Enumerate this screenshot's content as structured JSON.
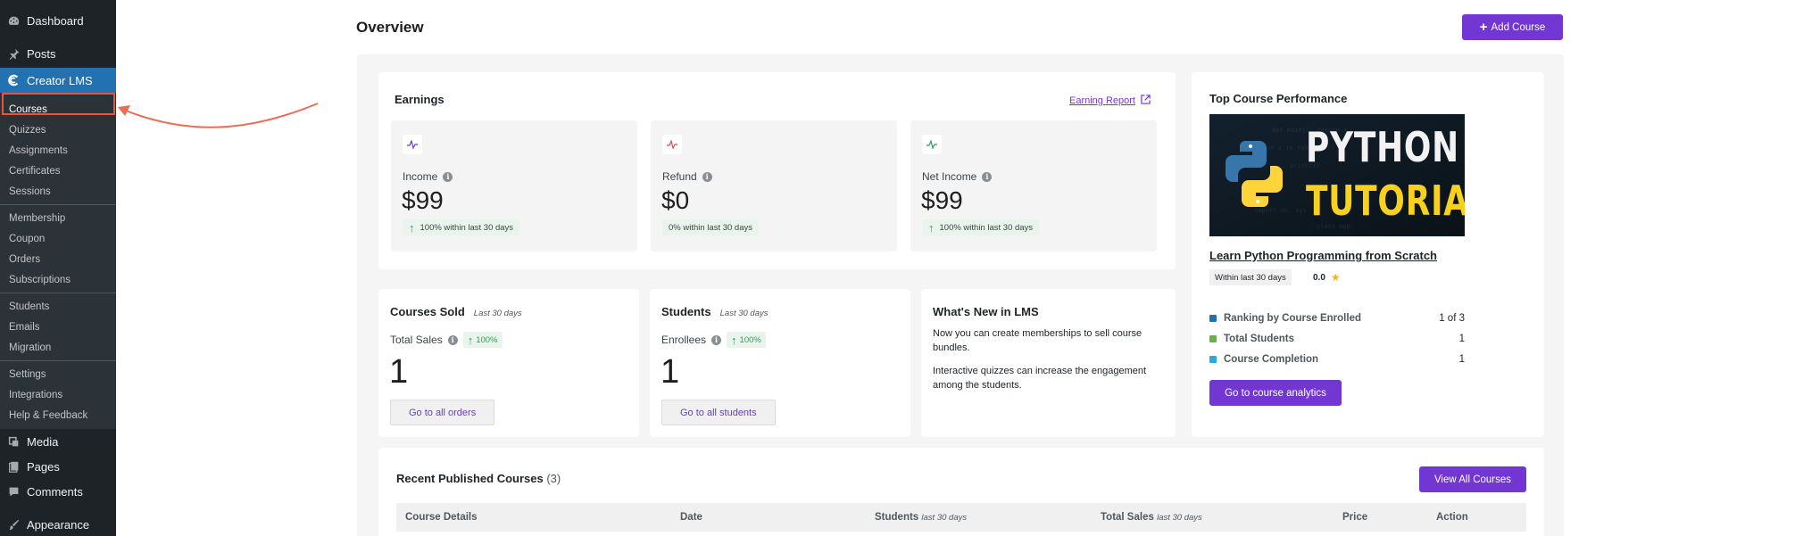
{
  "sidebar": {
    "top_items": [
      {
        "label": "Dashboard",
        "icon": "dashboard-icon"
      },
      {
        "label": "Posts",
        "icon": "pin-icon"
      },
      {
        "label": "Creator LMS",
        "icon": "creator-lms-icon"
      }
    ],
    "lms_group1": [
      "Courses",
      "Quizzes",
      "Assignments",
      "Certificates",
      "Sessions"
    ],
    "lms_group2": [
      "Membership",
      "Coupon",
      "Orders",
      "Subscriptions"
    ],
    "lms_group3": [
      "Students",
      "Emails",
      "Migration"
    ],
    "lms_group4": [
      "Settings",
      "Integrations",
      "Help & Feedback"
    ],
    "bottom_items": [
      {
        "label": "Media",
        "icon": "media-icon"
      },
      {
        "label": "Pages",
        "icon": "pages-icon"
      },
      {
        "label": "Comments",
        "icon": "comment-icon"
      },
      {
        "label": "Appearance",
        "icon": "brush-icon"
      }
    ]
  },
  "header": {
    "title": "Overview",
    "add_course": "Add Course"
  },
  "earnings": {
    "title": "Earnings",
    "report_link": "Earning Report",
    "stats": [
      {
        "label": "Income",
        "value": "$99",
        "change": "100% within last 30 days",
        "trend": "up",
        "icon_color": "#7237d3"
      },
      {
        "label": "Refund",
        "value": "$0",
        "change": "0% within last 30 days",
        "trend": "none",
        "icon_color": "#e5484d"
      },
      {
        "label": "Net Income",
        "value": "$99",
        "change": "100% within last 30 days",
        "trend": "up",
        "icon_color": "#2e9d56"
      }
    ]
  },
  "courses_sold": {
    "title": "Courses Sold",
    "period": "Last 30 days",
    "metric_label": "Total Sales",
    "pct": "100%",
    "value": "1",
    "button": "Go to all orders"
  },
  "students": {
    "title": "Students",
    "period": "Last 30 days",
    "metric_label": "Enrollees",
    "pct": "100%",
    "value": "1",
    "button": "Go to all students"
  },
  "whats_new": {
    "title": "What's New in LMS",
    "items": [
      "Now you can create memberships to sell course bundles.",
      "Interactive quizzes can increase the engagement among the students."
    ]
  },
  "top_course": {
    "title": "Top Course Performance",
    "thumb_line1": "PYTHON",
    "thumb_line2": "TUTORIAL",
    "course_name": "Learn Python Programming from Scratch",
    "within": "Within last 30 days",
    "rating": "0.0",
    "metrics": [
      {
        "label": "Ranking by Course Enrolled",
        "value": "1 of 3",
        "color": "#2271b1"
      },
      {
        "label": "Total Students",
        "value": "1",
        "color": "#68b04f"
      },
      {
        "label": "Course Completion",
        "value": "1",
        "color": "#2aa9e0"
      }
    ],
    "button": "Go to course analytics"
  },
  "recent": {
    "title": "Recent Published Courses",
    "count": "(3)",
    "view_all": "View All Courses",
    "columns": {
      "details": "Course Details",
      "date": "Date",
      "students": "Students",
      "students_note": "last 30 days",
      "sales": "Total Sales",
      "sales_note": "last 30 days",
      "price": "Price",
      "action": "Action"
    }
  }
}
